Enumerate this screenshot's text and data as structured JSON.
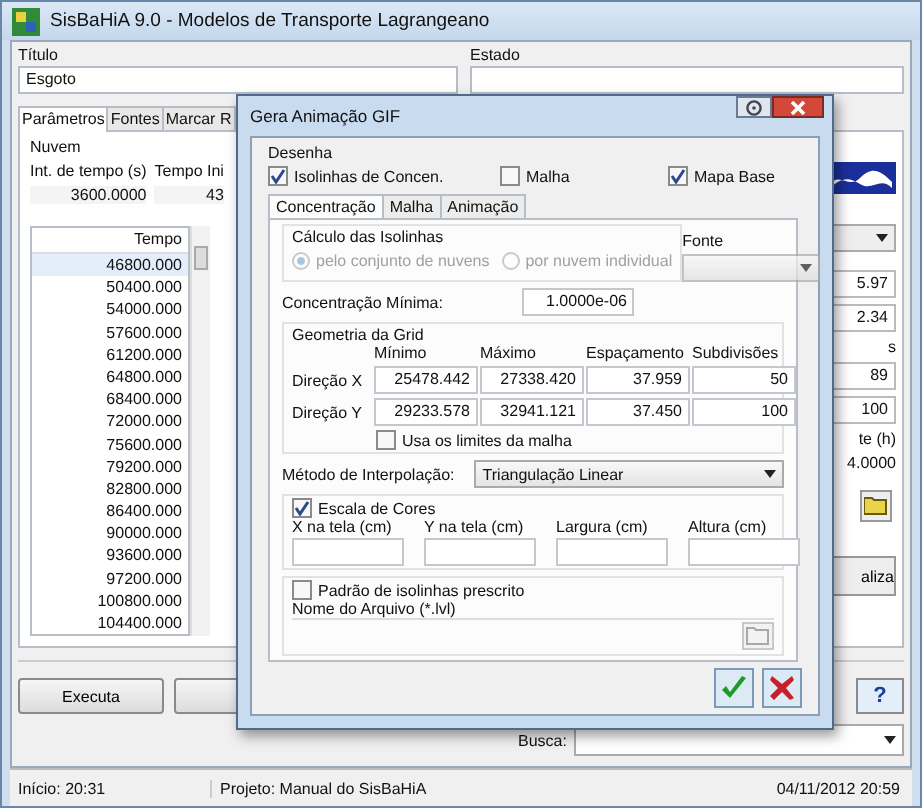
{
  "window": {
    "title": "SisBaHiA 9.0 - Modelos de Transporte Lagrangeano"
  },
  "form": {
    "title_label": "Título",
    "title_value": "Esgoto",
    "state_label": "Estado"
  },
  "tabs": [
    {
      "label": "Parâmetros",
      "selected": true
    },
    {
      "label": "Fontes",
      "selected": false
    },
    {
      "label": "Marcar R",
      "selected": false
    }
  ],
  "nuvem": {
    "label": "Nuvem",
    "columns": [
      {
        "label": "Int. de tempo (s)",
        "value": "3600.0000"
      },
      {
        "label": "Tempo Ini",
        "value": "43"
      }
    ]
  },
  "time_table": {
    "header": "Tempo",
    "rows": [
      "46800.000",
      "50400.000",
      "54000.000",
      "57600.000",
      "61200.000",
      "64800.000",
      "68400.000",
      "72000.000",
      "75600.000",
      "79200.000",
      "82800.000",
      "86400.000",
      "90000.000",
      "93600.000",
      "97200.000",
      "100800.000",
      "104400.000"
    ]
  },
  "right_panel": {
    "fields_1": [
      "5.97",
      "2.34"
    ],
    "label_1": "s",
    "fields_2": [
      "89",
      "100"
    ],
    "label_2": "te (h)",
    "value": "4.0000",
    "button": "aliza"
  },
  "buttons": [
    "Executa"
  ],
  "help_button": "?",
  "search": {
    "label": "Busca:"
  },
  "status_bar": [
    "Início: 20:31",
    "Projeto: Manual do SisBaHiA",
    "04/11/2012 20:59"
  ],
  "dialog": {
    "title": "Gera Animação GIF",
    "draw_label": "Desenha",
    "draw_options": [
      {
        "label": "Isolinhas de Concen.",
        "checked": true
      },
      {
        "label": "Malha",
        "checked": false
      },
      {
        "label": "Mapa Base",
        "checked": true
      }
    ],
    "tabs": [
      {
        "label": "Concentração",
        "selected": true
      },
      {
        "label": "Malha",
        "selected": false
      },
      {
        "label": "Animação",
        "selected": false
      }
    ],
    "isolines": {
      "label": "Cálculo das Isolinhas",
      "options": [
        {
          "label": "pelo conjunto de nuvens",
          "selected": true
        },
        {
          "label": "por nuvem individual",
          "selected": false
        }
      ],
      "disabled": true
    },
    "source": {
      "label": "Fonte",
      "disabled": true
    },
    "min_conc": {
      "label": "Concentração Mínima:",
      "value": "1.0000e-06"
    },
    "grid": {
      "label": "Geometria da Grid",
      "columns": [
        "Mínimo",
        "Máximo",
        "Espaçamento",
        "Subdivisões"
      ],
      "rows": [
        {
          "label": "Direção X",
          "values": [
            "25478.442",
            "27338.420",
            "37.959",
            "50"
          ]
        },
        {
          "label": "Direção Y",
          "values": [
            "29233.578",
            "32941.121",
            "37.450",
            "100"
          ]
        }
      ]
    },
    "use_mesh_limits": {
      "label": "Usa os limites da malha",
      "checked": false
    },
    "interpolation": {
      "label": "Método de Interpolação:",
      "value": "Triangulação Linear"
    },
    "color_scale": {
      "label": "Escala de Cores",
      "checked": true,
      "fields": [
        "X na tela (cm)",
        "Y na tela (cm)",
        "Largura (cm)",
        "Altura (cm)"
      ]
    },
    "prescribed": {
      "label": "Padrão de isolinhas prescrito",
      "checked": false,
      "file_label": "Nome do Arquivo (*.lvl)"
    }
  }
}
